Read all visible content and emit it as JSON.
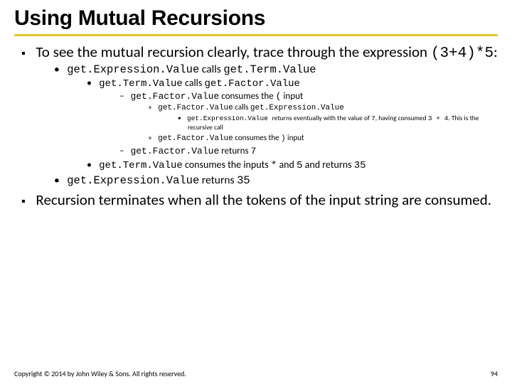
{
  "title": "Using Mutual Recursions",
  "bullets": {
    "b1a": "To see the mutual recursion clearly, trace through the expression ",
    "b1b": "(3+4)*5",
    "b1c": ":",
    "b2a": "get.Expression.Value",
    "b2b": " calls ",
    "b2c": "get.Term.Value",
    "b3a": "get.Term.Value",
    "b3b": " calls ",
    "b3c": "get.Factor.Value",
    "b4a": "get.Factor.Value",
    "b4b": " consumes the ",
    "b4c": "(",
    "b4d": " input",
    "b5a": "get.Factor.Value",
    "b5b": " calls ",
    "b5c": "get.Expression.Value",
    "b6a": "get.Expression.Value ",
    "b6b": "returns eventually with the value of ",
    "b6c": "7",
    "b6d": ", having consumed ",
    "b6e": "3 + 4",
    "b6f": ". This is the recursive call",
    "b7a": "get.Factor.Value",
    "b7b": " consumes the ",
    "b7c": ")",
    "b7d": " input",
    "b8a": "get.Factor.Value",
    "b8b": " returns ",
    "b8c": "7",
    "b9a": "get.Term.Value",
    "b9b": " consumes the inputs ",
    "b9c": "*",
    "b9d": " and ",
    "b9e": "5",
    "b9f": " and returns ",
    "b9g": "35",
    "b10a": "get.Expression.Value",
    "b10b": " returns ",
    "b10c": "35",
    "b11": "Recursion terminates when all the tokens of the input string are consumed."
  },
  "footer": {
    "copyright": "Copyright © 2014 by John Wiley & Sons. All rights reserved.",
    "page": "94"
  }
}
